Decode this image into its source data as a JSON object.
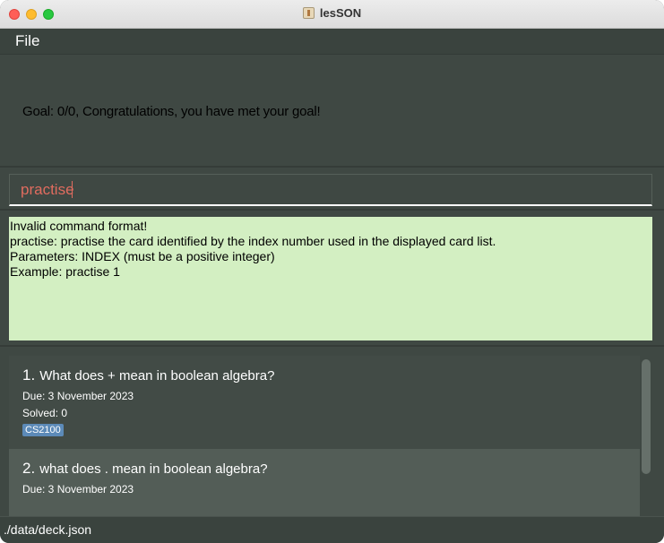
{
  "window": {
    "title": "lesSON"
  },
  "menu": {
    "items": [
      {
        "label": "File"
      }
    ]
  },
  "goal": {
    "text": "Goal: 0/0, Congratulations, you have met your goal!"
  },
  "command": {
    "value": "practise"
  },
  "result": {
    "lines": [
      "Invalid command format!",
      "practise: practise the card identified by the index number used in the displayed card list.",
      "Parameters: INDEX (must be a positive integer)",
      "Example: practise 1"
    ]
  },
  "cards": [
    {
      "index": "1.",
      "question": "What does + mean in boolean algebra?",
      "due": "Due: 3 November 2023",
      "solved": "Solved: 0",
      "tag": "CS2100"
    },
    {
      "index": "2.",
      "question": "what does . mean in boolean algebra?",
      "due": "Due: 3 November 2023"
    }
  ],
  "status": {
    "path": "./data/deck.json"
  },
  "colors": {
    "background": "#3f4843",
    "result_background": "#d3efc2",
    "command_text": "#e06c5f",
    "tag": "#5c8ab8"
  }
}
